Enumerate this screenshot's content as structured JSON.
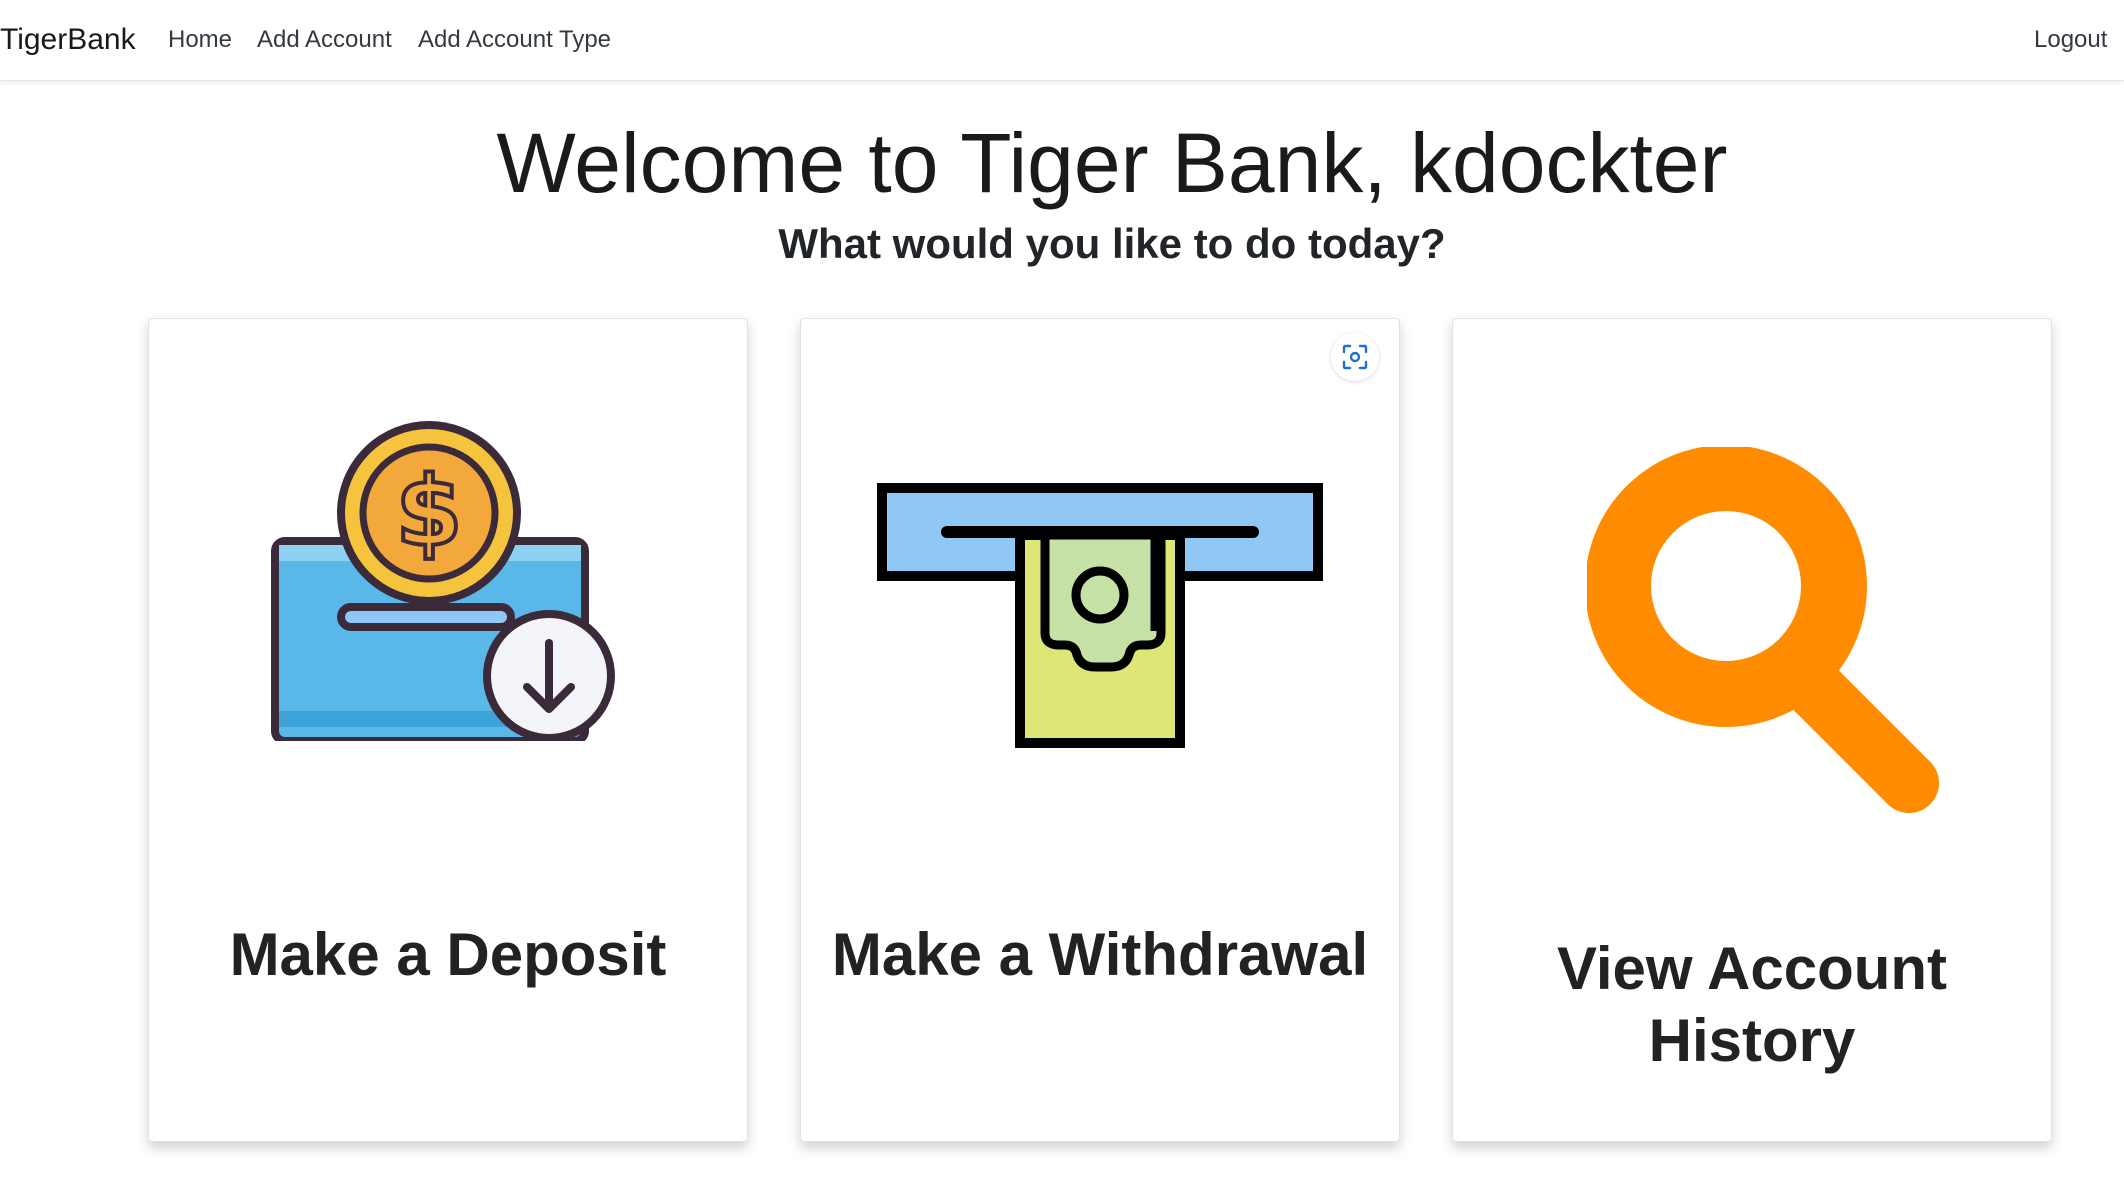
{
  "nav": {
    "brand": "TigerBank",
    "links": [
      "Home",
      "Add Account",
      "Add Account Type"
    ],
    "logout": "Logout"
  },
  "main": {
    "welcome": "Welcome to Tiger Bank, kdockter",
    "subtitle": "What would you like to do today?"
  },
  "cards": [
    {
      "title": "Make a Deposit",
      "icon": "deposit-icon"
    },
    {
      "title": "Make a Withdrawal",
      "icon": "withdrawal-icon"
    },
    {
      "title_line1": "View Account",
      "title_line2": "History",
      "icon": "search-icon"
    }
  ],
  "colors": {
    "coin": "#f6c33c",
    "coin_inner": "#f2a83a",
    "box": "#5ab8e8",
    "slot": "#8dc7f5",
    "bill": "#c5e1a5",
    "bill_bottom": "#dce775",
    "magnifier": "#ff8c00",
    "outline": "#3b2a3a"
  }
}
